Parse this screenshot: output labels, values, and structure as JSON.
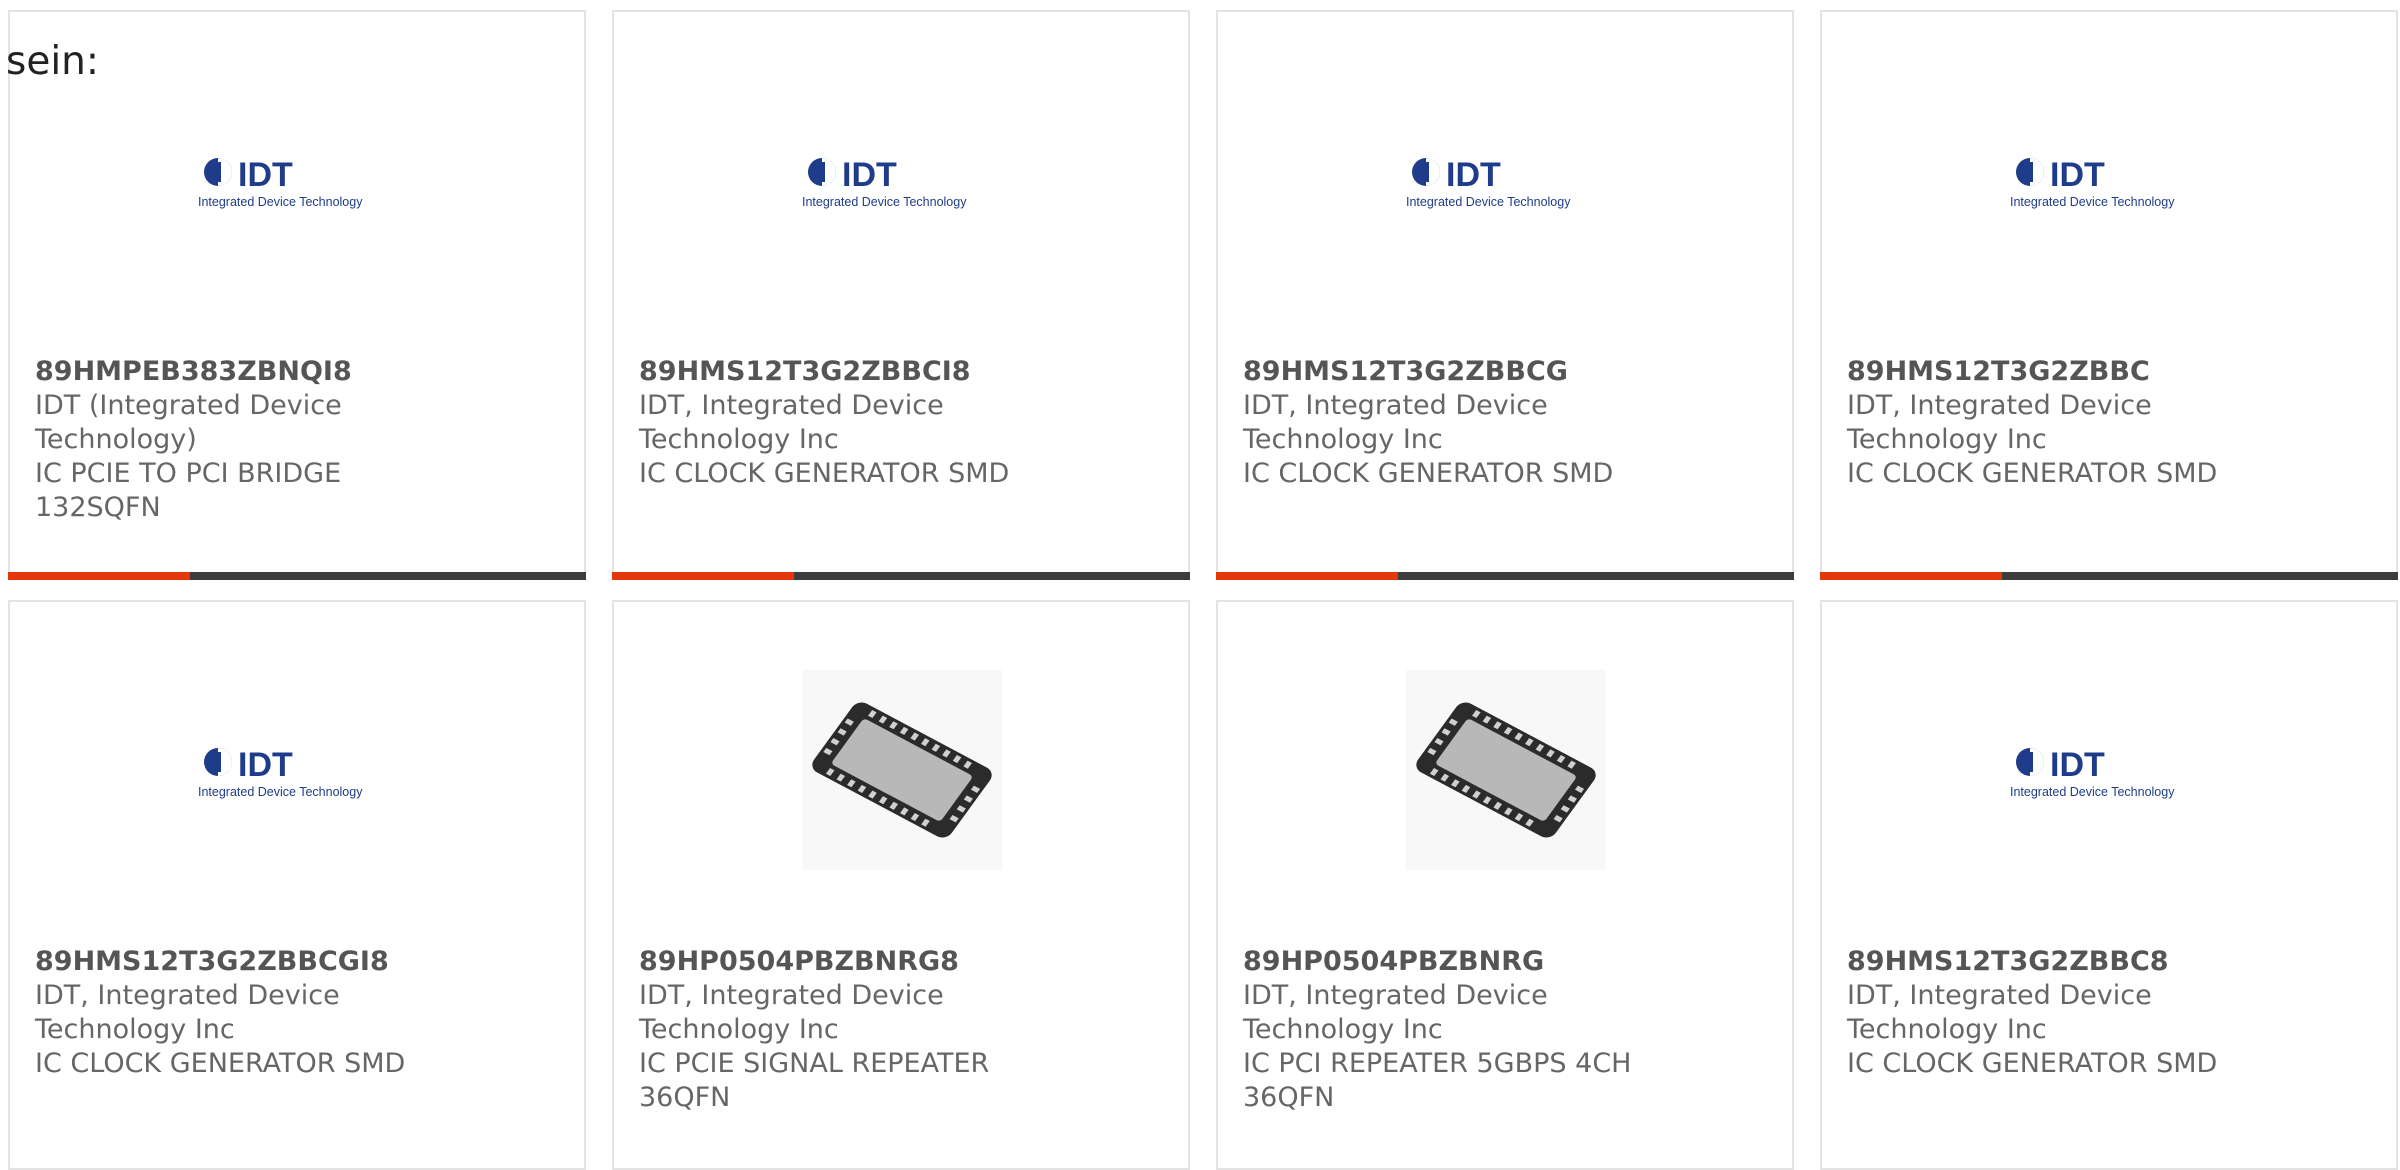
{
  "intro_text": "sein:",
  "colors": {
    "accent": "#e4380b",
    "bar": "#3d3d3d",
    "border": "#e3e3e3",
    "text": "#666666"
  },
  "logo": {
    "brand": "IDT",
    "brand_sub": "Integrated Device Technology"
  },
  "products": [
    {
      "part_number": "89HMPEB383ZBNQI8",
      "manufacturer": "IDT (Integrated Device Technology)",
      "description": "IC PCIE TO PCI BRIDGE 132SQFN",
      "image": "idt-logo"
    },
    {
      "part_number": "89HMS12T3G2ZBBCI8",
      "manufacturer": "IDT, Integrated Device Technology Inc",
      "description": "IC CLOCK GENERATOR SMD",
      "image": "idt-logo"
    },
    {
      "part_number": "89HMS12T3G2ZBBCG",
      "manufacturer": "IDT, Integrated Device Technology Inc",
      "description": "IC CLOCK GENERATOR SMD",
      "image": "idt-logo"
    },
    {
      "part_number": "89HMS12T3G2ZBBC",
      "manufacturer": "IDT, Integrated Device Technology Inc",
      "description": "IC CLOCK GENERATOR SMD",
      "image": "idt-logo"
    },
    {
      "part_number": "89HMS12T3G2ZBBCGI8",
      "manufacturer": "IDT, Integrated Device Technology Inc",
      "description": "IC CLOCK GENERATOR SMD",
      "image": "idt-logo"
    },
    {
      "part_number": "89HP0504PBZBNRG8",
      "manufacturer": "IDT, Integrated Device Technology Inc",
      "description": "IC PCIE SIGNAL REPEATER 36QFN",
      "image": "qfn-chip"
    },
    {
      "part_number": "89HP0504PBZBNRG",
      "manufacturer": "IDT, Integrated Device Technology Inc",
      "description": "IC PCI REPEATER 5GBPS 4CH 36QFN",
      "image": "qfn-chip"
    },
    {
      "part_number": "89HMS12T3G2ZBBC8",
      "manufacturer": "IDT, Integrated Device Technology Inc",
      "description": "IC CLOCK GENERATOR SMD",
      "image": "idt-logo"
    }
  ]
}
